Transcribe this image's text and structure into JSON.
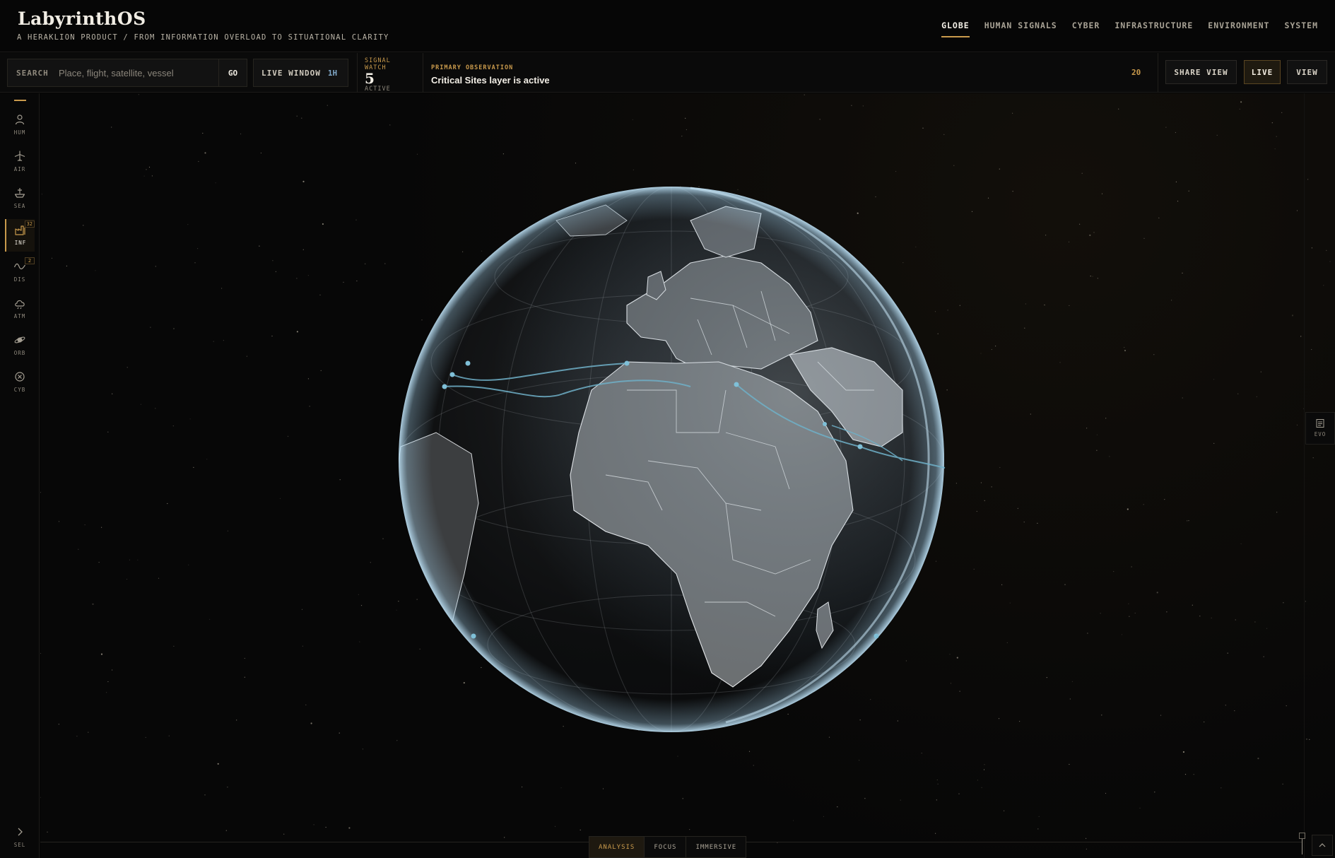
{
  "brand": {
    "title": "LabyrinthOS",
    "subtitle": "A HERAKLION PRODUCT / FROM INFORMATION OVERLOAD TO SITUATIONAL CLARITY"
  },
  "nav": {
    "active": "GLOBE",
    "items": [
      "GLOBE",
      "HUMAN SIGNALS",
      "CYBER",
      "INFRASTRUCTURE",
      "ENVIRONMENT",
      "SYSTEM"
    ]
  },
  "command_bar": {
    "search": {
      "label": "SEARCH",
      "placeholder": "Place, flight, satellite, vessel",
      "value": "",
      "go_label": "GO"
    },
    "live_window": {
      "label": "LIVE WINDOW",
      "value": "1H"
    },
    "signal_watch": {
      "label": "SIGNAL WATCH",
      "count": "5",
      "status": "ACTIVE"
    },
    "primary_observation": {
      "label": "PRIMARY OBSERVATION",
      "text": "Critical Sites layer is active",
      "count": "20"
    },
    "buttons": {
      "share_view": "SHARE VIEW",
      "live": "LIVE",
      "view": "VIEW"
    }
  },
  "layer_rail": {
    "items": [
      {
        "code": "HUM",
        "icon": "person-icon",
        "badge": ""
      },
      {
        "code": "AIR",
        "icon": "airplane-icon",
        "badge": ""
      },
      {
        "code": "SEA",
        "icon": "ship-icon",
        "badge": ""
      },
      {
        "code": "INF",
        "icon": "factory-icon",
        "badge": "32",
        "active": true
      },
      {
        "code": "DIS",
        "icon": "wave-icon",
        "badge": "2"
      },
      {
        "code": "ATM",
        "icon": "cloud-icon",
        "badge": ""
      },
      {
        "code": "ORB",
        "icon": "planet-icon",
        "badge": ""
      },
      {
        "code": "CYB",
        "icon": "cyber-icon",
        "badge": ""
      }
    ],
    "expand_label": "SEL"
  },
  "right_rail": {
    "evo_label": "EVO",
    "icon": "document-icon"
  },
  "modes": {
    "active": "ANALYSIS",
    "items": [
      "ANALYSIS",
      "FOCUS",
      "IMMERSIVE"
    ]
  },
  "colors": {
    "accent": "#c99a4c",
    "route": "#6fb0c8",
    "globe_rim": "#9ec8e0",
    "background": "#050505"
  }
}
